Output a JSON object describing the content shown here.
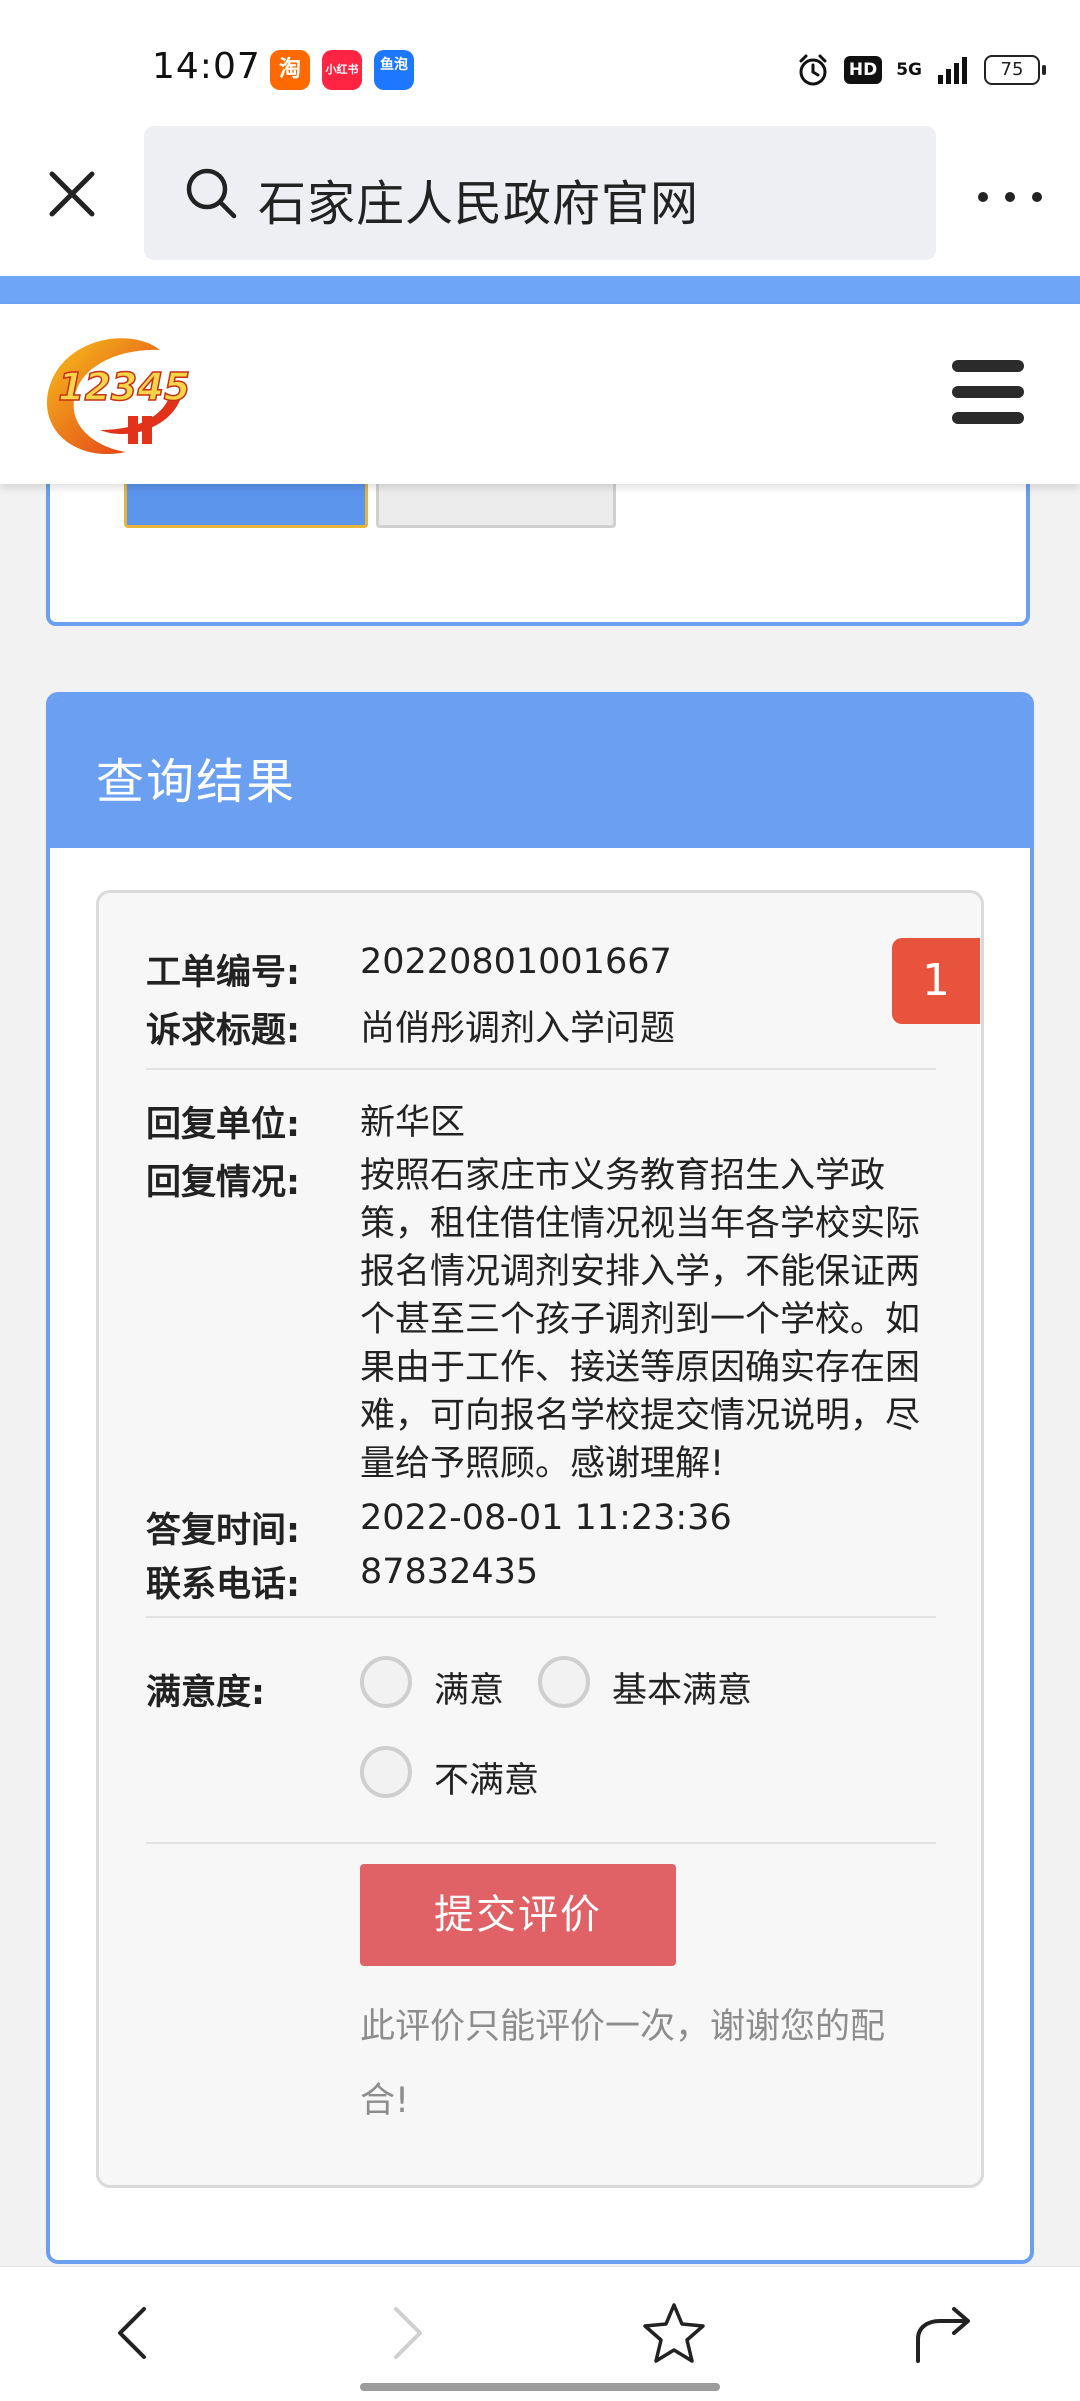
{
  "status_bar": {
    "time": "14:07",
    "apps": [
      {
        "name": "taobao",
        "label": "淘",
        "color": "#ff6a00"
      },
      {
        "name": "xiaohongshu",
        "label": "小红书",
        "color": "#ff2442"
      },
      {
        "name": "yupao",
        "label": "鱼泡",
        "color": "#1e78ff"
      }
    ],
    "hd": "HD",
    "network": "5G",
    "battery": "75"
  },
  "browser": {
    "search_text": "石家庄人民政府官网",
    "close_icon": "close-icon",
    "more_icon": "more-dots-icon"
  },
  "site": {
    "logo_text": "12345",
    "menu_icon": "hamburger-menu-icon"
  },
  "results": {
    "title": "查询结果",
    "index": "1",
    "fields": {
      "ticket_no_label": "工单编号:",
      "ticket_no": "20220801001667",
      "subject_label": "诉求标题:",
      "subject": "尚俏彤调剂入学问题",
      "reply_unit_label": "回复单位:",
      "reply_unit": "新华区",
      "reply_content_label": "回复情况:",
      "reply_content": "按照石家庄市义务教育招生入学政策，租住借住情况视当年各学校实际报名情况调剂安排入学，不能保证两个甚至三个孩子调剂到一个学校。如果由于工作、接送等原因确实存在困难，可向报名学校提交情况说明，尽量给予照顾。感谢理解!",
      "reply_time_label": "答复时间:",
      "reply_time": "2022-08-01 11:23:36",
      "phone_label": "联系电话:",
      "phone": "87832435"
    },
    "satisfaction": {
      "label": "满意度:",
      "options": [
        "满意",
        "基本满意",
        "不满意"
      ],
      "selected": null
    },
    "submit_label": "提交评价",
    "notice": "此评价只能评价一次，谢谢您的配合!"
  },
  "colors": {
    "accent_blue": "#6a9ff1",
    "badge_red": "#e8533d",
    "submit_red": "#e06267"
  }
}
